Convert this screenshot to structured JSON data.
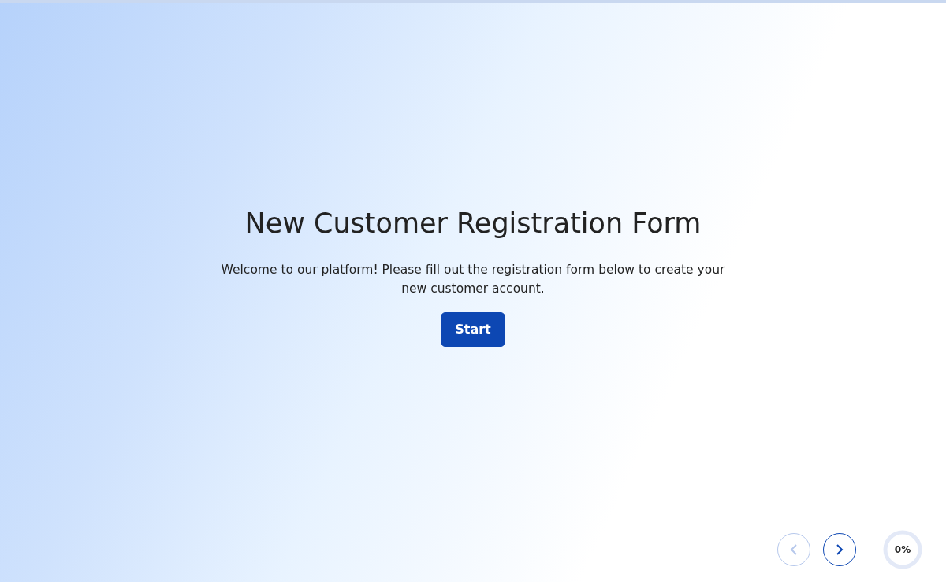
{
  "title": "New Customer Registration Form",
  "intro": "Welcome to our platform! Please fill out the registration form below to create your new customer account.",
  "start_button": "Start",
  "navigation": [
    {
      "kind": "previous",
      "disabled": true
    },
    {
      "kind": "next",
      "disabled": false
    }
  ],
  "progress": {
    "label": "0%",
    "level": 0
  }
}
